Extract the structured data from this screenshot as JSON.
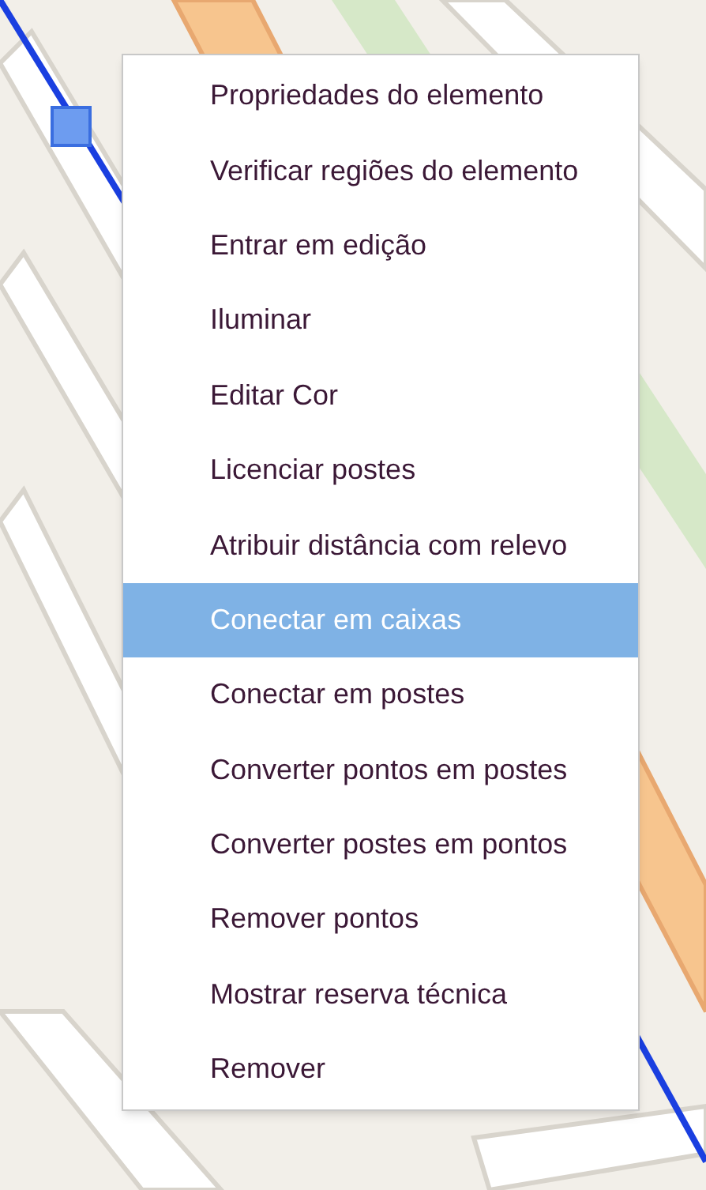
{
  "context_menu": {
    "items": [
      {
        "label": "Propriedades do elemento",
        "selected": false
      },
      {
        "label": "Verificar regiões do elemento",
        "selected": false
      },
      {
        "label": "Entrar em edição",
        "selected": false
      },
      {
        "label": "Iluminar",
        "selected": false
      },
      {
        "label": "Editar Cor",
        "selected": false
      },
      {
        "label": "Licenciar postes",
        "selected": false
      },
      {
        "label": "Atribuir distância com relevo",
        "selected": false
      },
      {
        "label": "Conectar em caixas",
        "selected": true
      },
      {
        "label": "Conectar em postes",
        "selected": false
      },
      {
        "label": "Converter pontos em postes",
        "selected": false
      },
      {
        "label": "Converter postes em pontos",
        "selected": false
      },
      {
        "label": "Remover pontos",
        "selected": false
      },
      {
        "label": "Mostrar reserva técnica",
        "selected": false
      },
      {
        "label": "Remover",
        "selected": false
      }
    ]
  }
}
